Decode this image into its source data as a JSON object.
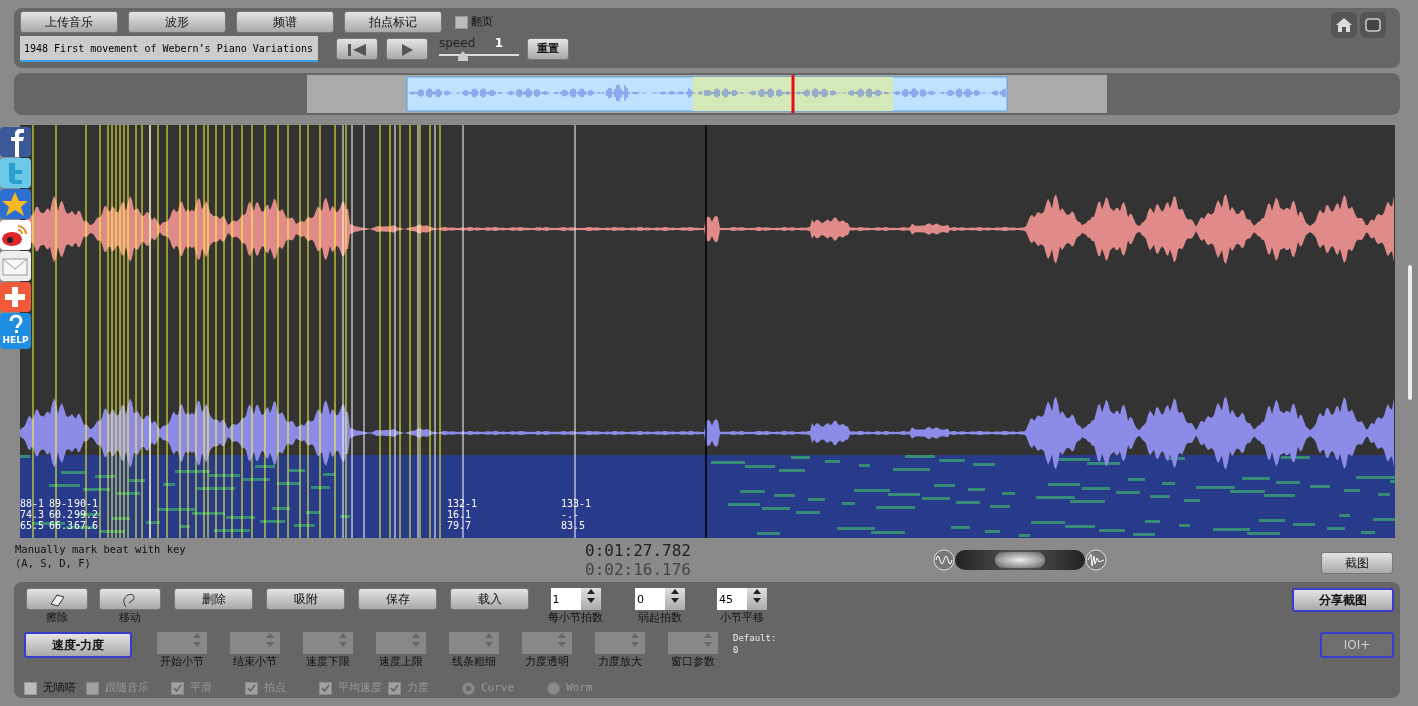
{
  "toolbar": {
    "buttons": [
      {
        "label": "上传音乐"
      },
      {
        "label": "波形"
      },
      {
        "label": "频谱"
      },
      {
        "label": "拍点标记"
      }
    ],
    "page_flip": {
      "label": "翻页",
      "checked": false
    },
    "track_title": "1948 First movement of Webern’s Piano Variations",
    "speed": {
      "label": "speed",
      "value": "1",
      "level": 0.3
    },
    "reset_button": "重置"
  },
  "share_icons": [
    {
      "kind": "facebook"
    },
    {
      "kind": "twitter"
    },
    {
      "kind": "star"
    },
    {
      "kind": "weibo"
    },
    {
      "kind": "mail"
    },
    {
      "kind": "plus"
    },
    {
      "kind": "help",
      "label": "HELP"
    }
  ],
  "beat_labels": [
    {
      "bar": "88-1",
      "tempo": "74.3",
      "dynamics": "65.5"
    },
    {
      "bar": "89-1",
      "tempo": "60.2",
      "dynamics": "66.3"
    },
    {
      "bar": "90-1",
      "tempo": "99.2",
      "dynamics": "67.6"
    },
    {
      "bar": "132-1",
      "tempo": "16.1",
      "dynamics": "79.7"
    },
    {
      "bar": "133-1",
      "tempo": "-.-",
      "dynamics": "83.5"
    }
  ],
  "hint": [
    "Manually mark beat with key",
    "(A, S, D, F)"
  ],
  "zoom": {
    "level": 0.5
  },
  "current_time": "0:01:27.782",
  "total_time": "0:02:16.176",
  "screenshot_button": "截图",
  "tools": [
    {
      "kind": "eraser",
      "label": "擦除"
    },
    {
      "kind": "hand",
      "label": "移动"
    },
    {
      "kind": "text",
      "label": "删除"
    },
    {
      "kind": "text",
      "label": "吸附"
    },
    {
      "kind": "text",
      "label": "保存"
    },
    {
      "kind": "text",
      "label": "载入"
    }
  ],
  "spinners": [
    {
      "label": "每小节拍数",
      "value": "1"
    },
    {
      "label": "弱起拍数",
      "value": "0"
    },
    {
      "label": "小节平移",
      "value": "45"
    }
  ],
  "share_button": "分享截图",
  "mode_button": "速度-力度",
  "params": [
    {
      "label": "开始小节",
      "disabled": true
    },
    {
      "label": "结束小节",
      "disabled": true
    },
    {
      "label": "速度下限",
      "disabled": true
    },
    {
      "label": "速度上限",
      "disabled": true
    },
    {
      "label": "线条粗细",
      "disabled": true
    },
    {
      "label": "力度透明",
      "disabled": true
    },
    {
      "label": "力度放大",
      "disabled": true
    },
    {
      "label": "窗口参数",
      "disabled": true
    }
  ],
  "default_note": [
    "Default:",
    "0"
  ],
  "extra_button": {
    "label": "IOI+",
    "disabled": true
  },
  "options": [
    {
      "kind": "checkbox",
      "label": "无嘀嗒",
      "checked": false,
      "disabled": false
    },
    {
      "kind": "checkbox",
      "label": "跟随音乐",
      "checked": false,
      "disabled": true
    },
    {
      "kind": "checkbox",
      "label": "平滑",
      "checked": true,
      "disabled": true
    },
    {
      "kind": "checkbox",
      "label": "拍点",
      "checked": true,
      "disabled": true
    },
    {
      "kind": "checkbox",
      "label": "平均速度",
      "checked": true,
      "disabled": true
    },
    {
      "kind": "checkbox",
      "label": "力度",
      "checked": true,
      "disabled": true
    },
    {
      "kind": "radio",
      "label": "Curve",
      "selected": true,
      "disabled": true
    },
    {
      "kind": "radio",
      "label": "Worm",
      "selected": false,
      "disabled": true
    }
  ]
}
